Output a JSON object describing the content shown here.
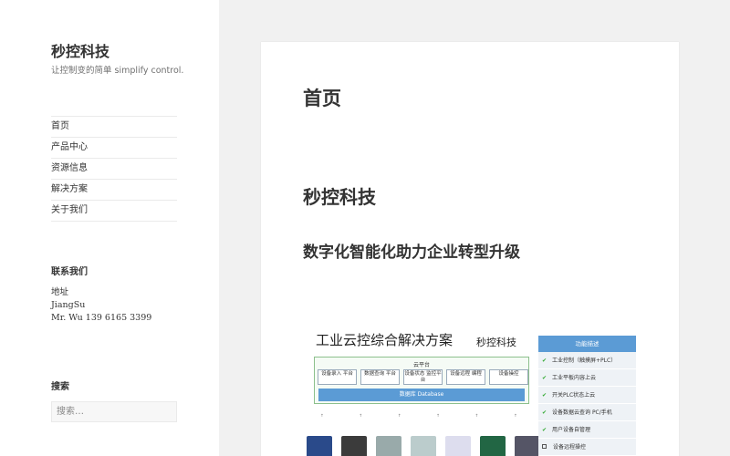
{
  "site": {
    "title": "秒控科技",
    "description": "让控制变的简单 simplify control."
  },
  "nav": [
    {
      "label": "首页"
    },
    {
      "label": "产品中心"
    },
    {
      "label": "资源信息"
    },
    {
      "label": "解决方案"
    },
    {
      "label": "关于我们"
    }
  ],
  "contact": {
    "title": "联系我们",
    "line1": "地址",
    "line2": "JiangSu",
    "line3": "Mr. Wu 139 6165 3399"
  },
  "search": {
    "title": "搜索",
    "placeholder": "搜索…"
  },
  "main": {
    "page_title": "首页",
    "heading1": "秒控科技",
    "heading2": "数字化智能化助力企业转型升级"
  },
  "figure": {
    "title": "工业云控综合解决方案",
    "brand": "秒控科技",
    "cloud_label": "云平台",
    "cloud_items": [
      "设备录入 平台",
      "数据查询 平台",
      "设备状态 监控平台",
      "设备远程 编程",
      "设备操控"
    ],
    "db_label": "数据库 Database",
    "func_header": "功能描述",
    "func_items": [
      {
        "label": "工业控制（触摸屏+PLC）",
        "checked": true
      },
      {
        "label": "工业平板内容上云",
        "checked": true
      },
      {
        "label": "开关PLC状态上云",
        "checked": true
      },
      {
        "label": "设备数据云查询 PC/手机",
        "checked": true
      },
      {
        "label": "用户设备自管理",
        "checked": true
      },
      {
        "label": "设备远程操控",
        "checked": false
      }
    ]
  },
  "colors": {
    "sidebar_bg": "#ffffff",
    "page_bg": "#f1f1f1",
    "accent_blue": "#5b9bd5",
    "check_green": "#33aa33"
  }
}
